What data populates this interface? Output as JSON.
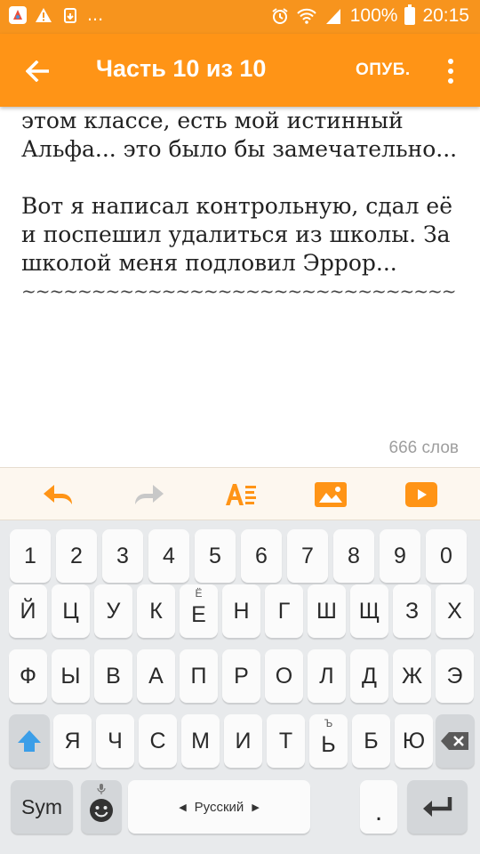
{
  "status_bar": {
    "ellipsis": "...",
    "battery_percent": "100%",
    "time": "20:15"
  },
  "app_bar": {
    "title": "Часть 10 из 10",
    "publish_label": "ОПУБ."
  },
  "editor": {
    "paragraphs": [
      "молочный шоколад. Возможно, в этом классе, есть мой истинный Альфа... это было бы замечательно...",
      "Вот я написал контрольную, сдал её и поспешил удалиться из школы. За школой меня подловил Эррор..."
    ],
    "separator": "~~~~~~~~~~~~~~~~~~~~~~~~~~~~~~~",
    "word_count": "666 слов"
  },
  "toolbar": {
    "icons": [
      "undo-icon",
      "redo-icon",
      "text-format-icon",
      "insert-image-icon",
      "insert-video-icon"
    ],
    "accent": "#ff9416",
    "disabled": "#c8c8c8"
  },
  "keyboard": {
    "row_numbers": [
      "1",
      "2",
      "3",
      "4",
      "5",
      "6",
      "7",
      "8",
      "9",
      "0"
    ],
    "row1": [
      "Й",
      "Ц",
      "У",
      "К",
      "Е",
      "Н",
      "Г",
      "Ш",
      "Щ",
      "З",
      "Х"
    ],
    "row1_hints": {
      "Е": "Ё"
    },
    "row2": [
      "Ф",
      "Ы",
      "В",
      "А",
      "П",
      "Р",
      "О",
      "Л",
      "Д",
      "Ж",
      "Э"
    ],
    "row3": [
      "Я",
      "Ч",
      "С",
      "М",
      "И",
      "Т",
      "Ь",
      "Б",
      "Ю"
    ],
    "row3_hints": {
      "Ь": "Ъ"
    },
    "sym_label": "Sym",
    "space_label": "Русский",
    "period_label": "."
  },
  "colors": {
    "status_bar": "#f7941d",
    "app_bar": "#ff9416",
    "shift_blue": "#3b9ee8"
  }
}
